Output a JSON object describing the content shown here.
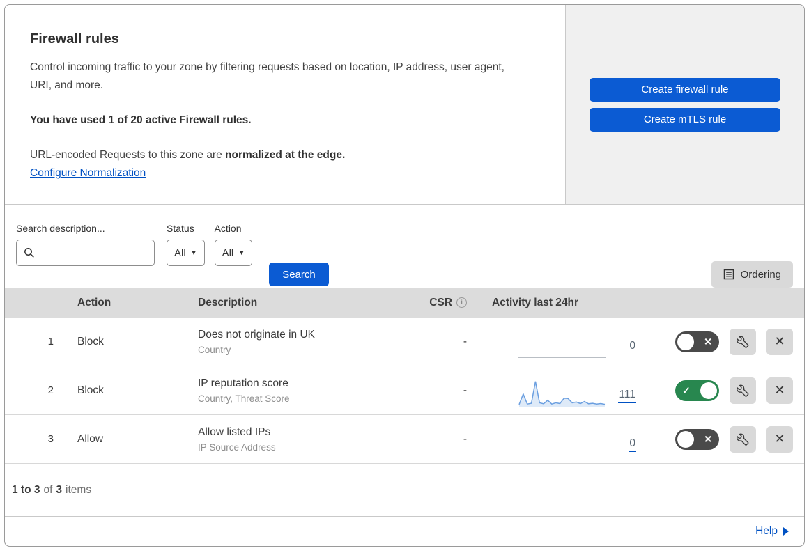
{
  "header": {
    "title": "Firewall rules",
    "description": "Control incoming traffic to your zone by filtering requests based on location, IP address, user agent, URI, and more.",
    "usage_bold": "You have used 1 of 20 active Firewall rules.",
    "normalization_prefix": "URL-encoded Requests to this zone are ",
    "normalization_bold": "normalized at the edge.",
    "normalization_link": "Configure Normalization",
    "buttons": {
      "create_firewall": "Create firewall rule",
      "create_mtls": "Create mTLS rule"
    }
  },
  "filters": {
    "search_label": "Search description...",
    "status_label": "Status",
    "status_value": "All",
    "action_label": "Action",
    "action_value": "All",
    "search_button": "Search",
    "ordering_button": "Ordering"
  },
  "table": {
    "headers": {
      "action": "Action",
      "description": "Description",
      "csr": "CSR",
      "activity": "Activity last 24hr"
    },
    "rows": [
      {
        "priority": "1",
        "action": "Block",
        "description": "Does not originate in UK",
        "fields": "Country",
        "csr": "-",
        "activity_count": "0",
        "enabled": false,
        "sparkline": []
      },
      {
        "priority": "2",
        "action": "Block",
        "description": "IP reputation score",
        "fields": "Country, Threat Score",
        "csr": "-",
        "activity_count": "111",
        "enabled": true,
        "sparkline": [
          3,
          45,
          5,
          8,
          95,
          10,
          6,
          20,
          5,
          10,
          7,
          28,
          27,
          10,
          13,
          7,
          15,
          6,
          8,
          5,
          7,
          4
        ]
      },
      {
        "priority": "3",
        "action": "Allow",
        "description": "Allow listed IPs",
        "fields": "IP Source Address",
        "csr": "-",
        "activity_count": "0",
        "enabled": false,
        "sparkline": []
      }
    ]
  },
  "footer": {
    "range_bold": "1 to 3",
    "of_text": "of",
    "total_bold": "3",
    "items_text": "items",
    "help_link": "Help"
  },
  "colors": {
    "accent_blue": "#0b5bd3",
    "link_blue": "#0051c3",
    "toggle_on_green": "#28874f",
    "toggle_off_gray": "#4a4a4a",
    "table_header_gray": "#dcdcdc",
    "panel_gray": "#f0f0f0",
    "sparkline_blue": "#6b9fe0",
    "sparkline_fill": "rgba(160,195,235,0.35)"
  }
}
